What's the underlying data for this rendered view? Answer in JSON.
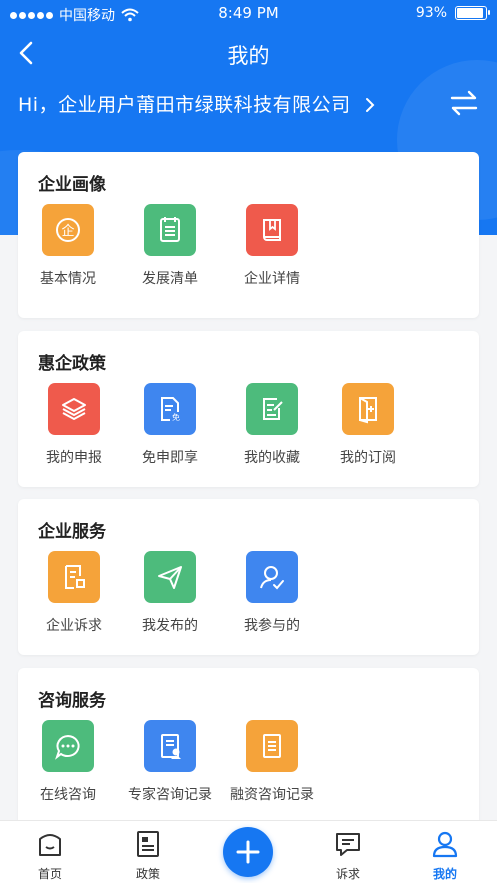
{
  "status_bar": {
    "carrier": "中国移动",
    "time": "8:49 PM",
    "battery": "93%",
    "battery_level": 0.93
  },
  "nav": {
    "title": "我的"
  },
  "company": {
    "greeting": "Hi，企业用户莆田市绿联科技有限公司"
  },
  "sections": [
    {
      "title": "企业画像",
      "items": [
        {
          "label": "基本情况",
          "icon": "enterprise-badge-icon",
          "color": "#f5a33a"
        },
        {
          "label": "发展清单",
          "icon": "checklist-icon",
          "color": "#4dbb7c"
        },
        {
          "label": "企业详情",
          "icon": "book-icon",
          "color": "#ef5a4c"
        }
      ]
    },
    {
      "title": "惠企政策",
      "items": [
        {
          "label": "我的申报",
          "icon": "layers-icon",
          "color": "#ef5a4c"
        },
        {
          "label": "免申即享",
          "icon": "document-exempt-icon",
          "color": "#3f86ef"
        },
        {
          "label": "我的收藏",
          "icon": "edit-document-icon",
          "color": "#4dbb7c"
        },
        {
          "label": "我的订阅",
          "icon": "subscribe-book-icon",
          "color": "#f5a33a"
        }
      ]
    },
    {
      "title": "企业服务",
      "items": [
        {
          "label": "企业诉求",
          "icon": "appeal-document-icon",
          "color": "#f5a33a"
        },
        {
          "label": "我发布的",
          "icon": "paper-plane-icon",
          "color": "#4dbb7c"
        },
        {
          "label": "我参与的",
          "icon": "user-check-icon",
          "color": "#3f86ef"
        }
      ]
    },
    {
      "title": "咨询服务",
      "items": [
        {
          "label": "在线咨询",
          "icon": "chat-bubble-icon",
          "color": "#4dbb7c"
        },
        {
          "label": "专家咨询记录",
          "icon": "expert-record-icon",
          "color": "#3f86ef"
        },
        {
          "label": "融资咨询记录",
          "icon": "finance-record-icon",
          "color": "#f5a33a"
        }
      ]
    }
  ],
  "tabbar": {
    "home": "首页",
    "policy": "政策",
    "appeal": "诉求",
    "mine": "我的",
    "active": "mine"
  },
  "colors": {
    "primary": "#1677f2"
  }
}
